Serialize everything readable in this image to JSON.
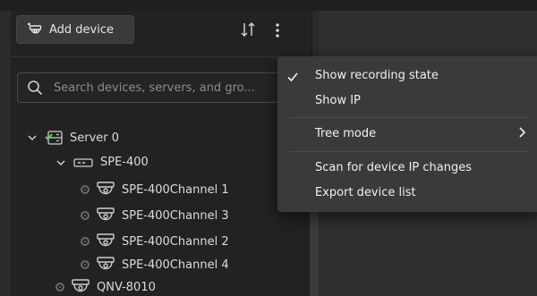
{
  "toolbar": {
    "add_device_label": "Add device"
  },
  "search": {
    "placeholder": "Search devices, servers, and gro..."
  },
  "tree": {
    "server": "Server 0",
    "nvr": "SPE-400",
    "channels": [
      "SPE-400Channel 1",
      "SPE-400Channel 3",
      "SPE-400Channel 2",
      "SPE-400Channel 4"
    ],
    "camera": "QNV-8010"
  },
  "menu": {
    "items": [
      {
        "label": "Show recording state",
        "checked": true
      },
      {
        "label": "Show IP",
        "checked": false
      },
      {
        "label": "Tree mode",
        "submenu": true
      },
      {
        "label": "Scan for device IP changes"
      },
      {
        "label": "Export device list"
      }
    ]
  },
  "icons": {
    "add_device": "add-device-icon",
    "sort": "sort-icon",
    "more": "more-vertical-icon",
    "search": "search-icon",
    "server": "server-icon",
    "nvr": "nvr-icon",
    "camera": "camera-icon",
    "recording_indicator": "recording-dot-icon",
    "check": "check-icon",
    "chevron": "chevron-right-icon"
  },
  "colors": {
    "server_status": "#5fd35a",
    "menu_bg": "#3a3a3a",
    "panel_bg": "#222222"
  }
}
